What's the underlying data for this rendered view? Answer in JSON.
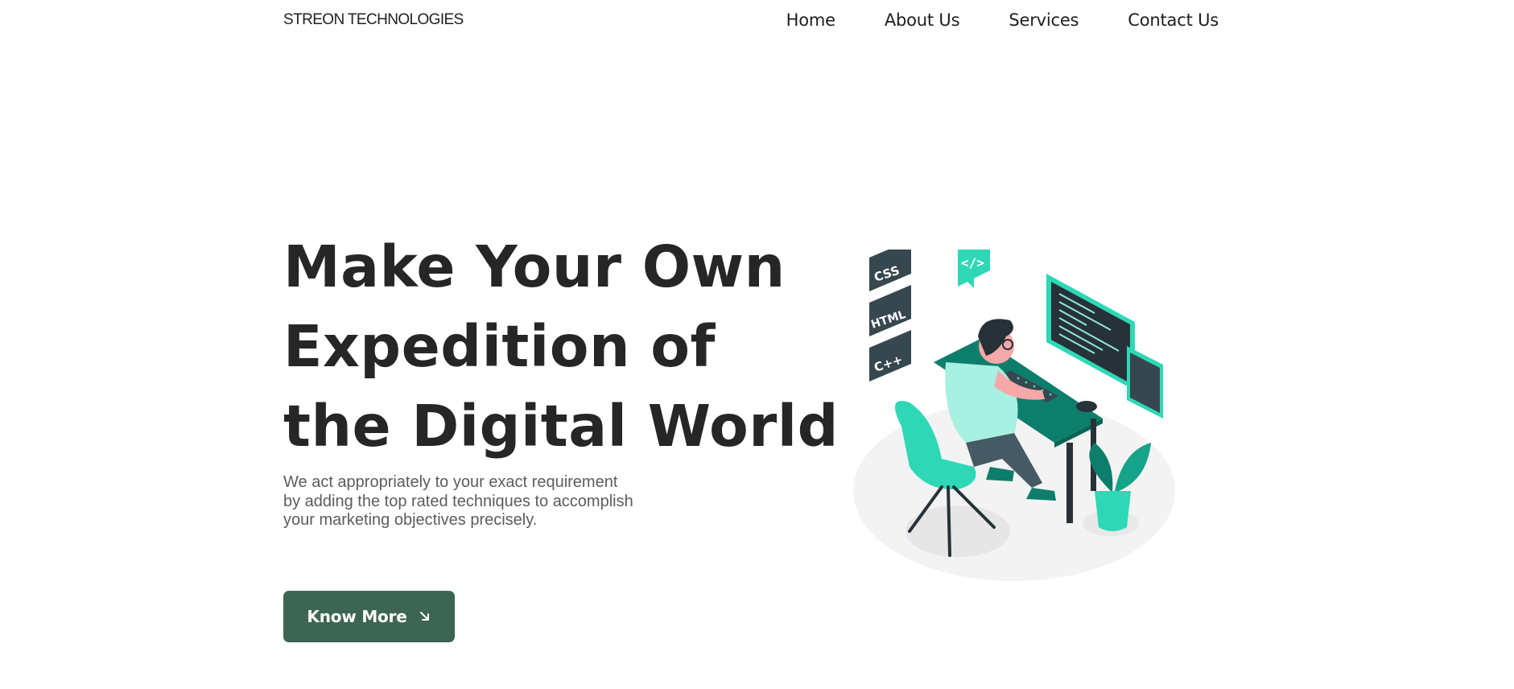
{
  "header": {
    "brand": "STREON TECHNOLOGIES",
    "nav": [
      {
        "label": "Home"
      },
      {
        "label": "About Us"
      },
      {
        "label": "Services"
      },
      {
        "label": "Contact Us"
      }
    ]
  },
  "hero": {
    "title_lines": [
      "Make Your Own",
      "Expedition of",
      "the Digital World"
    ],
    "description": "We act appropriately to your exact requirement by adding the top rated techniques to accomplish your marketing objectives precisely.",
    "cta_label": "Know More",
    "cta_icon": "arrow-down-right-icon"
  },
  "illustration": {
    "badges": [
      "CSS",
      "HTML",
      "C++"
    ],
    "code_bubble": "</>",
    "icon": "developer-at-desk-illustration"
  },
  "colors": {
    "accent": "#3d6553",
    "teal": "#2ed8b6",
    "dark_teal": "#0e7e6c",
    "text": "#262626",
    "muted": "#5c5c5c"
  }
}
